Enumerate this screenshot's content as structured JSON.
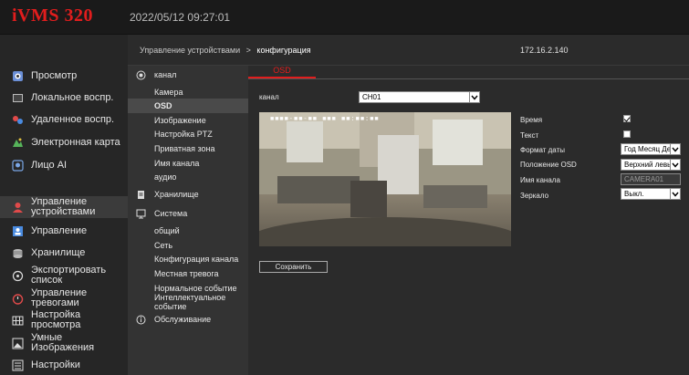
{
  "app": {
    "logo": "iVMS 320",
    "datetime": "2022/05/12 09:27:01"
  },
  "header": {
    "breadcrumb_parent": "Управление устройствами",
    "breadcrumb_sep": ">",
    "breadcrumb_current": "конфигурация",
    "ip": "172.16.2.140"
  },
  "sidebar": {
    "items": [
      {
        "label": "Просмотр",
        "icon": "monitor-icon"
      },
      {
        "label": "Локальное воспр.",
        "icon": "local-playback-icon"
      },
      {
        "label": "Удаленное воспр.",
        "icon": "remote-playback-icon"
      },
      {
        "label": "Электронная карта",
        "icon": "map-icon"
      },
      {
        "label": "Лицо AI",
        "icon": "face-icon"
      },
      {
        "label": "Управление устройствами",
        "icon": "user-icon",
        "active": true
      },
      {
        "label": "Управление",
        "icon": "account-icon"
      },
      {
        "label": "Хранилище",
        "icon": "storage-icon"
      },
      {
        "label": "Экспортировать список",
        "icon": "export-icon"
      },
      {
        "label": "Управление тревогами",
        "icon": "alarm-icon"
      },
      {
        "label": "Настройка просмотра",
        "icon": "grid-icon"
      },
      {
        "label": "Умные Изображения",
        "icon": "smart-image-icon"
      },
      {
        "label": "Настройки",
        "icon": "settings-icon"
      }
    ]
  },
  "submenu": {
    "channel": "канал",
    "camera": "Камера",
    "osd": "OSD",
    "image": "Изображение",
    "ptz": "Настройка PTZ",
    "privacy": "Приватная зона",
    "channel_name": "Имя канала",
    "audio": "аудио",
    "storage": "Хранилище",
    "system": "Система",
    "general": "общий",
    "network": "Сеть",
    "channel_config": "Конфигурация канала",
    "local_alarm": "Местная тревога",
    "normal_event": "Нормальное событие",
    "intelligent_event": "Интеллектуальное событие",
    "maintenance": "Обслуживание"
  },
  "main": {
    "tab": "OSD",
    "channel_label": "канал",
    "channel_value": "CH01",
    "time_label": "Время",
    "time_checked": true,
    "text_label": "Текст",
    "text_checked": false,
    "date_format_label": "Формат даты",
    "date_format_value": "Год Месяц День",
    "osd_position_label": "Положение OSD",
    "osd_position_value": "Верхний левый",
    "channel_name_label": "Имя канала",
    "channel_name_value": "CAMERA01",
    "mirror_label": "Зеркало",
    "mirror_value": "Выкл.",
    "save_label": "Сохранить",
    "osd_overlay": "■■■■-■■-■■ ■■■ ■■:■■:■■"
  },
  "colors": {
    "accent": "#e11d1d"
  }
}
